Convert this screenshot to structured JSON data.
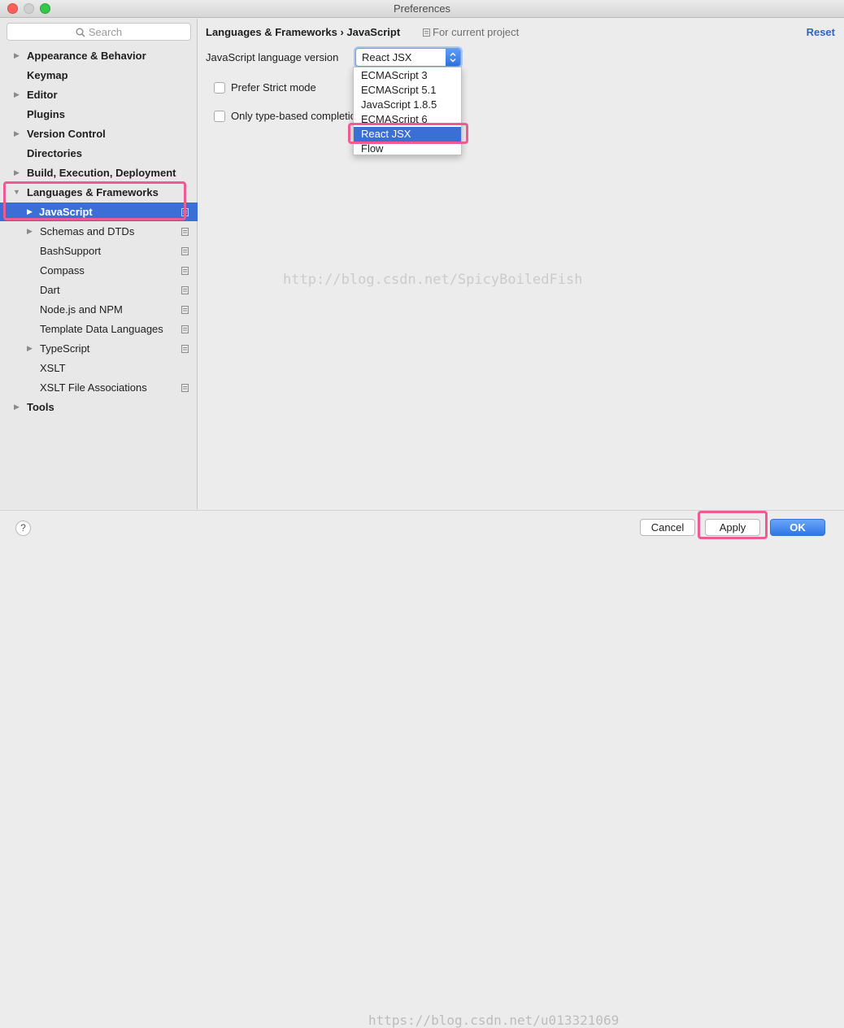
{
  "window": {
    "title": "Preferences"
  },
  "search": {
    "placeholder": "Search"
  },
  "sidebar": {
    "items": [
      {
        "label": "Appearance & Behavior"
      },
      {
        "label": "Keymap"
      },
      {
        "label": "Editor"
      },
      {
        "label": "Plugins"
      },
      {
        "label": "Version Control"
      },
      {
        "label": "Directories"
      },
      {
        "label": "Build, Execution, Deployment"
      },
      {
        "label": "Languages & Frameworks"
      },
      {
        "label": "JavaScript"
      },
      {
        "label": "Schemas and DTDs"
      },
      {
        "label": "BashSupport"
      },
      {
        "label": "Compass"
      },
      {
        "label": "Dart"
      },
      {
        "label": "Node.js and NPM"
      },
      {
        "label": "Template Data Languages"
      },
      {
        "label": "TypeScript"
      },
      {
        "label": "XSLT"
      },
      {
        "label": "XSLT File Associations"
      },
      {
        "label": "Tools"
      }
    ]
  },
  "main": {
    "breadcrumb": "Languages & Frameworks › JavaScript",
    "scope": "For current project",
    "reset": "Reset",
    "language_version_label": "JavaScript language version",
    "language_version_value": "React JSX",
    "options": [
      "ECMAScript 3",
      "ECMAScript 5.1",
      "JavaScript 1.8.5",
      "ECMAScript 6",
      "React JSX",
      "Flow"
    ],
    "checkbox_strict": "Prefer Strict mode",
    "checkbox_typebased": "Only type-based completion"
  },
  "watermark": {
    "center": "http://blog.csdn.net/SpicyBoiledFish",
    "bottom": "https://blog.csdn.net/u013321069"
  },
  "buttons": {
    "help": "?",
    "cancel": "Cancel",
    "apply": "Apply",
    "ok": "OK"
  },
  "colors": {
    "selection": "#3b6fd6",
    "highlight": "#ee5a93",
    "link": "#2f64c5"
  }
}
